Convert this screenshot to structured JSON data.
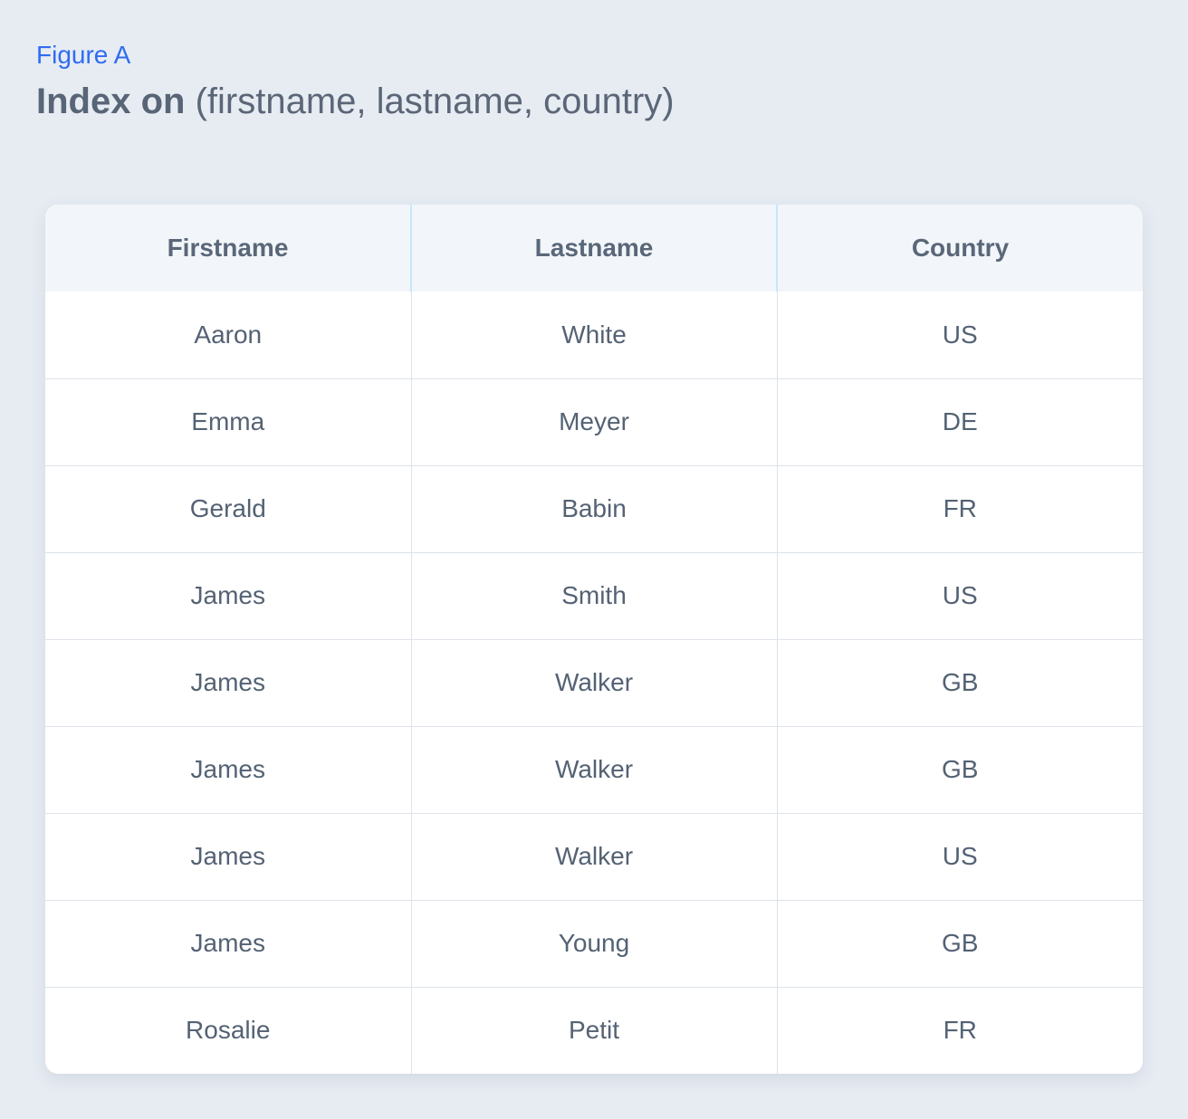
{
  "figure_label": "Figure A",
  "title": {
    "bold": "Index on",
    "rest": " (firstname, lastname, country)"
  },
  "table": {
    "headers": [
      "Firstname",
      "Lastname",
      "Country"
    ],
    "rows": [
      [
        "Aaron",
        "White",
        "US"
      ],
      [
        "Emma",
        "Meyer",
        "DE"
      ],
      [
        "Gerald",
        "Babin",
        "FR"
      ],
      [
        "James",
        "Smith",
        "US"
      ],
      [
        "James",
        "Walker",
        "GB"
      ],
      [
        "James",
        "Walker",
        "GB"
      ],
      [
        "James",
        "Walker",
        "US"
      ],
      [
        "James",
        "Young",
        "GB"
      ],
      [
        "Rosalie",
        "Petit",
        "FR"
      ]
    ]
  },
  "colors": {
    "background": "#e7ecf3",
    "figure_label": "#2f6cf2",
    "header_row": "#f2f6fa",
    "header_divider": "#c8e6fb",
    "text": "#546274"
  }
}
